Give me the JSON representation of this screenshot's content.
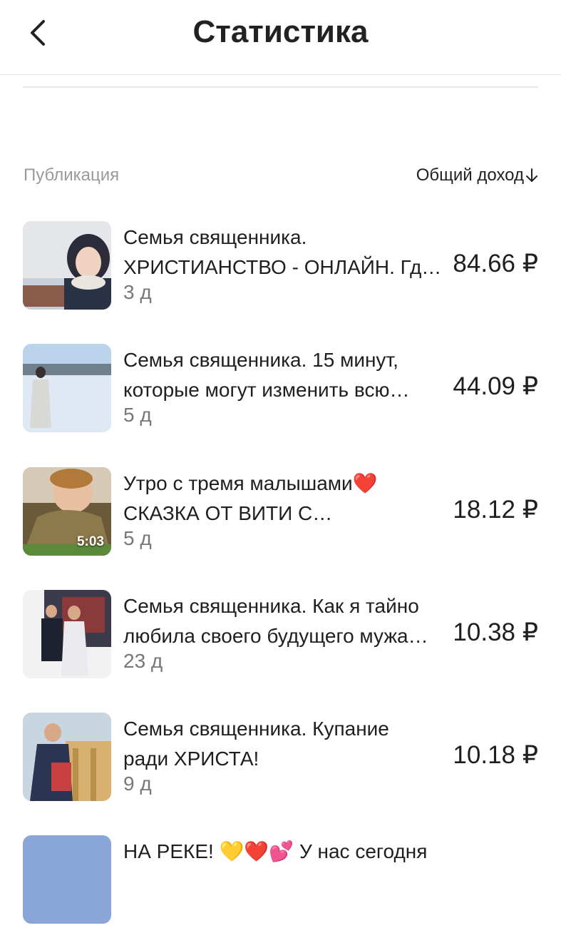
{
  "header": {
    "title": "Статистика"
  },
  "table": {
    "col_publication": "Публикация",
    "col_income": "Общий доход"
  },
  "rows": [
    {
      "line1": "Семья священника.",
      "line2": "ХРИСТИАНСТВО - ОНЛАЙН. Гд…",
      "age": "3 д",
      "amount": "84.66 ₽"
    },
    {
      "line1": "Семья священника. 15 минут,",
      "line2": "которые могут изменить всю…",
      "age": "5 д",
      "amount": "44.09 ₽"
    },
    {
      "line1": "Утро с тремя малышами❤️",
      "line2": "СКАЗКА ОТ ВИТИ С…",
      "age": "5 д",
      "amount": "18.12 ₽",
      "duration": "5:03"
    },
    {
      "line1": "Семья священника. Как я тайно",
      "line2": "любила своего будущего мужа…",
      "age": "23 д",
      "amount": "10.38 ₽"
    },
    {
      "line1": "Семья священника. Купание",
      "line2": "ради ХРИСТА!",
      "age": "9 д",
      "amount": "10.18 ₽"
    },
    {
      "line1": "НА РЕКЕ! 💛❤️💕 У нас сегодня",
      "line2": "",
      "age": "",
      "amount": ""
    }
  ]
}
